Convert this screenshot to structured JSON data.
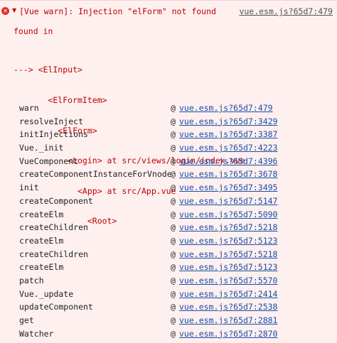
{
  "header": {
    "icon": "error-circle-icon",
    "disclosure": "▼",
    "message": "[Vue warn]: Injection \"elForm\" not found",
    "source": "vue.esm.js?65d7:479"
  },
  "found_in": "found in",
  "tree": [
    "---> <ElInput>",
    "       <ElFormItem>",
    "         <ElForm>",
    "           <Login> at src/views/login/index.vue",
    "             <App> at src/App.vue",
    "               <Root>"
  ],
  "stack": [
    {
      "fn": "warn",
      "at": "@",
      "loc": "vue.esm.js?65d7:479"
    },
    {
      "fn": "resolveInject",
      "at": "@",
      "loc": "vue.esm.js?65d7:3429"
    },
    {
      "fn": "initInjections",
      "at": "@",
      "loc": "vue.esm.js?65d7:3387"
    },
    {
      "fn": "Vue._init",
      "at": "@",
      "loc": "vue.esm.js?65d7:4223"
    },
    {
      "fn": "VueComponent",
      "at": "@",
      "loc": "vue.esm.js?65d7:4396"
    },
    {
      "fn": "createComponentInstanceForVnode",
      "at": "@",
      "loc": "vue.esm.js?65d7:3678"
    },
    {
      "fn": "init",
      "at": "@",
      "loc": "vue.esm.js?65d7:3495"
    },
    {
      "fn": "createComponent",
      "at": "@",
      "loc": "vue.esm.js?65d7:5147"
    },
    {
      "fn": "createElm",
      "at": "@",
      "loc": "vue.esm.js?65d7:5090"
    },
    {
      "fn": "createChildren",
      "at": "@",
      "loc": "vue.esm.js?65d7:5218"
    },
    {
      "fn": "createElm",
      "at": "@",
      "loc": "vue.esm.js?65d7:5123"
    },
    {
      "fn": "createChildren",
      "at": "@",
      "loc": "vue.esm.js?65d7:5218"
    },
    {
      "fn": "createElm",
      "at": "@",
      "loc": "vue.esm.js?65d7:5123"
    },
    {
      "fn": "patch",
      "at": "@",
      "loc": "vue.esm.js?65d7:5570"
    },
    {
      "fn": "Vue._update",
      "at": "@",
      "loc": "vue.esm.js?65d7:2414"
    },
    {
      "fn": "updateComponent",
      "at": "@",
      "loc": "vue.esm.js?65d7:2538"
    },
    {
      "fn": "get",
      "at": "@",
      "loc": "vue.esm.js?65d7:2881"
    },
    {
      "fn": "Watcher",
      "at": "@",
      "loc": "vue.esm.js?65d7:2870"
    }
  ],
  "colors": {
    "background": "#fff0f0",
    "error_text": "#c00000",
    "link": "#1a4ea6",
    "icon": "#e0302f"
  }
}
